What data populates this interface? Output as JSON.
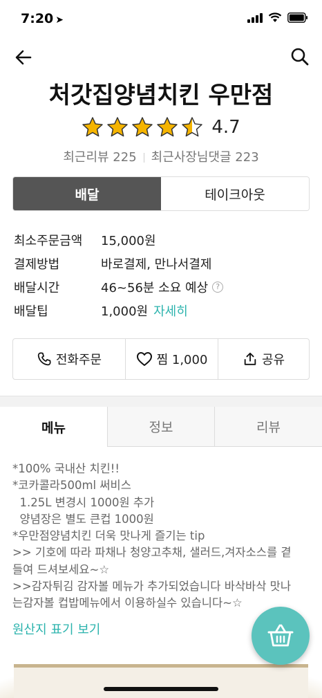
{
  "status_bar": {
    "time": "7:20",
    "location_arrow": "➤"
  },
  "header": {
    "back_icon": "arrow-left-icon",
    "search_icon": "search-icon"
  },
  "store": {
    "name": "처갓집양념치킨 우만점",
    "rating": "4.7",
    "stars_filled": 4.5,
    "recent_reviews": "최근리뷰 225",
    "owner_replies": "최근사장님댓글 223"
  },
  "order_type": {
    "delivery": "배달",
    "takeout": "테이크아웃",
    "selected": "delivery"
  },
  "info": [
    {
      "label": "최소주문금액",
      "value": "15,000원"
    },
    {
      "label": "결제방법",
      "value": "바로결제, 만나서결제"
    },
    {
      "label": "배달시간",
      "value": "46~56분 소요 예상",
      "help": "?"
    },
    {
      "label": "배달팁",
      "value": "1,000원",
      "link": "자세히"
    }
  ],
  "actions": {
    "call": "전화주문",
    "favorite": "찜 1,000",
    "share": "공유"
  },
  "tabs": {
    "menu": "메뉴",
    "info": "정보",
    "review": "리뷰",
    "selected": "menu"
  },
  "description": [
    "*100% 국내산 치킨!!",
    "*코카콜라500ml 써비스",
    "  1.25L 변경시 1000원 추가",
    "  양념장은 별도 큰컵 1000원",
    "*우만점양념치킨 더욱 맛나게 즐기는 tip",
    ">> 기호에 따라 파채나 청양고추채, 샐러드,겨자소스를 곁",
    "들여 드셔보세요~☆",
    ">>감자튀김 감자볼 메뉴가 추가되었습니다 바삭바삭 맛나",
    "는감자볼 컵밥메뉴에서 이용하실수 있습니다~☆"
  ],
  "origin_link": "원산지 표기 보기",
  "cart_icon": "basket-icon",
  "colors": {
    "accent": "#2bb3ad",
    "cart": "#5bc3bd",
    "toggle_active": "#555555",
    "star": "#f5b400"
  }
}
